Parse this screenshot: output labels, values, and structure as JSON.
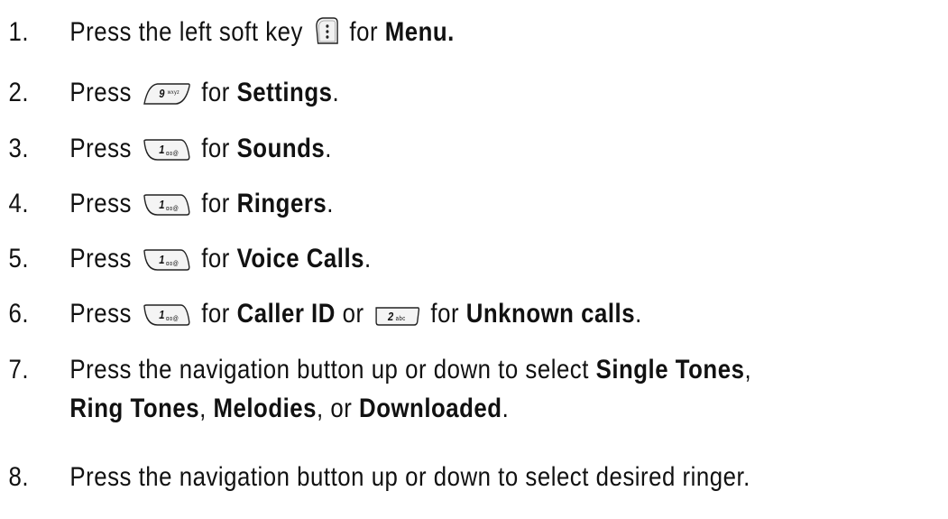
{
  "steps": [
    {
      "num": "1.",
      "a": "Press the left soft key",
      "key": "left-soft-key",
      "b": "for",
      "bold1": "Menu."
    },
    {
      "num": "2.",
      "a": "Press",
      "key": "9-key",
      "key_label": "9",
      "key_sub": "wxyz",
      "b": "for",
      "bold1": "Settings",
      "c": "."
    },
    {
      "num": "3.",
      "a": "Press",
      "key": "1-key",
      "key_label": "1",
      "key_sub": "ɑo@",
      "b": "for",
      "bold1": "Sounds",
      "c": "."
    },
    {
      "num": "4.",
      "a": "Press",
      "key": "1-key",
      "key_label": "1",
      "key_sub": "ɑo@",
      "b": "for",
      "bold1": "Ringers",
      "c": "."
    },
    {
      "num": "5.",
      "a": "Press",
      "key": "1-key",
      "key_label": "1",
      "key_sub": "ɑo@",
      "b": "for",
      "bold1": "Voice Calls",
      "c": "."
    },
    {
      "num": "6.",
      "a": "Press",
      "key": "1-key",
      "key_label": "1",
      "key_sub": "ɑo@",
      "b": "for",
      "bold1": "Caller ID",
      "d": "or",
      "key2": "2-key",
      "key2_label": "2",
      "key2_sub": "abc",
      "e": "for",
      "bold2": "Unknown calls",
      "c": "."
    },
    {
      "num": "7.",
      "a": "Press the navigation button up or down to select",
      "bold1": "Single Tones",
      "c": ",",
      "line2_bold1": "Ring Tones",
      "line2_sep1": ",",
      "line2_bold2": "Melodies",
      "line2_sep2": ", or",
      "line2_bold3": "Downloaded",
      "line2_end": "."
    },
    {
      "num": "8.",
      "a": "Press the navigation button up or down to select desired ringer."
    }
  ]
}
